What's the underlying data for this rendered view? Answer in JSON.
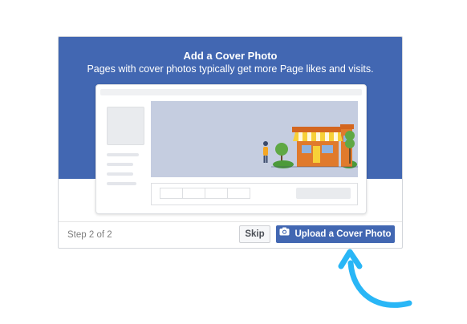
{
  "dialog": {
    "title": "Add a Cover Photo",
    "subtitle": "Pages with cover photos typically get more Page likes and visits.",
    "step_text": "Step 2 of 2",
    "skip_label": "Skip",
    "upload_label": "Upload a Cover Photo",
    "upload_icon": "camera-icon"
  },
  "colors": {
    "header": "#4267b2",
    "button_primary": "#4267b2",
    "arrow": "#29b6f6"
  }
}
